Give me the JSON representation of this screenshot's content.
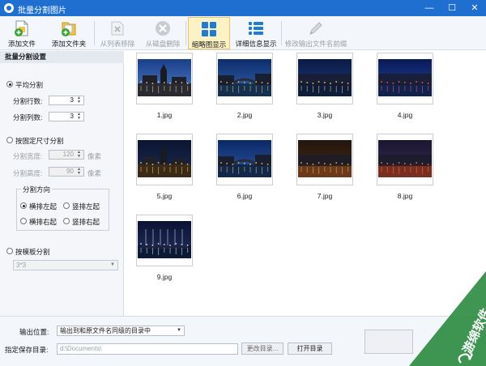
{
  "window": {
    "title": "批量分割图片",
    "minimize_glyph": "—",
    "maximize_glyph": "☐",
    "close_glyph": "✕"
  },
  "toolbar": {
    "add_file": "添加文件",
    "add_folder": "添加文件夹",
    "remove_from_list": "从列表移除",
    "delete_from_disk": "从磁盘删除",
    "thumbnail_view": "缩略图显示",
    "detail_view": "详细信息显示",
    "rename_prefix": "修改输出文件名前缀"
  },
  "settings": {
    "header": "批量分割设置",
    "even_split": {
      "label": "平均分割",
      "rows_label": "分割行数:",
      "rows": "3",
      "cols_label": "分割列数:",
      "cols": "3"
    },
    "fixed_size": {
      "label": "按固定尺寸分割",
      "width_label": "分割宽度:",
      "width": "120",
      "height_label": "分割高度:",
      "height": "90",
      "unit": "像素"
    },
    "direction": {
      "legend": "分割方向",
      "h_left": "横排左起",
      "v_left": "竖排左起",
      "h_right": "横排右起",
      "v_right": "竖排右起"
    },
    "template": {
      "label": "按模板分割",
      "value": "3*3"
    }
  },
  "thumbnails": [
    {
      "name": "1.jpg",
      "scene": "cathedral-dusk"
    },
    {
      "name": "2.jpg",
      "scene": "canal-dusk"
    },
    {
      "name": "3.jpg",
      "scene": "waterfront-night"
    },
    {
      "name": "4.jpg",
      "scene": "harbor-night"
    },
    {
      "name": "5.jpg",
      "scene": "tower-night"
    },
    {
      "name": "6.jpg",
      "scene": "canal-bridge-night"
    },
    {
      "name": "7.jpg",
      "scene": "market-street-night"
    },
    {
      "name": "8.jpg",
      "scene": "street-cafe-night"
    },
    {
      "name": "9.jpg",
      "scene": "harbor-masts-night"
    }
  ],
  "output": {
    "location_label": "输出位置:",
    "location_value": "输出到和原文件名同级的目录中",
    "dir_label": "指定保存目录:",
    "dir_value": "d:\\Documents\\",
    "change_dir": "更改目录...",
    "open_dir": "打开目录"
  },
  "watermark": {
    "text": "游绵软件"
  },
  "colors": {
    "titlebar": "#1e6fd0",
    "active_tool": "#fdf2c4",
    "panel_bg": "#f4f6f9"
  }
}
